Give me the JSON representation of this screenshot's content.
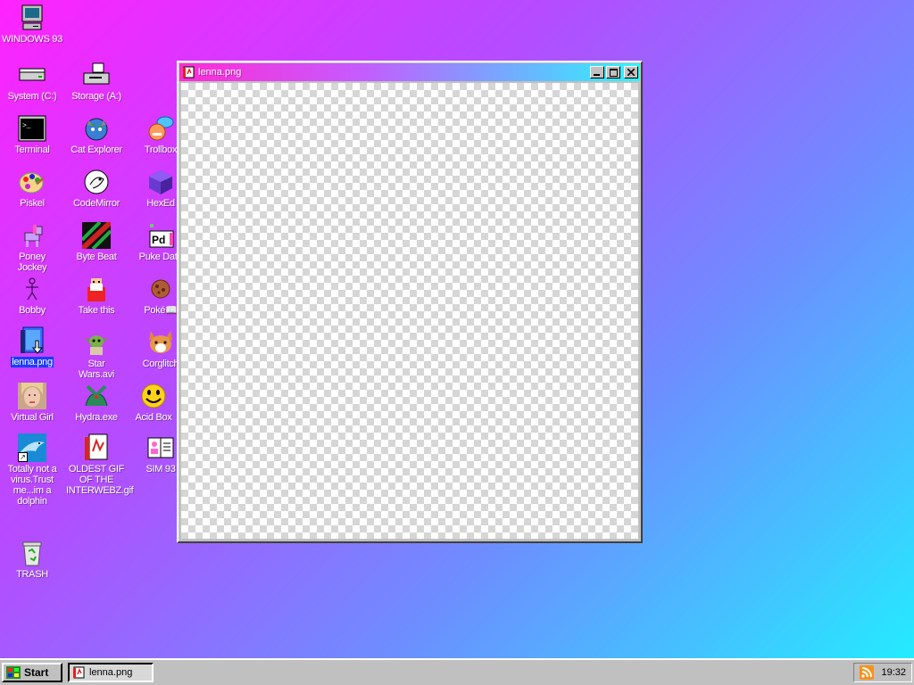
{
  "desktop": {
    "icons": [
      {
        "id": "windows93",
        "label": "WINDOWS 93",
        "icon": "computer-icon"
      },
      {
        "id": "system-c",
        "label": "System (C:)",
        "icon": "hard-drive-icon"
      },
      {
        "id": "storage-a",
        "label": "Storage (A:)",
        "icon": "floppy-drive-icon"
      },
      {
        "id": "terminal",
        "label": "Terminal",
        "icon": "terminal-icon"
      },
      {
        "id": "cat-explorer",
        "label": "Cat Explorer",
        "icon": "cat-globe-icon"
      },
      {
        "id": "trollbox",
        "label": "Trollbox",
        "icon": "chat-face-icon"
      },
      {
        "id": "piskel",
        "label": "Piskel",
        "icon": "paint-palette-icon"
      },
      {
        "id": "codemirror",
        "label": "CodeMirror",
        "icon": "codemirror-icon"
      },
      {
        "id": "hexed",
        "label": "HexEd",
        "icon": "purple-cube-icon"
      },
      {
        "id": "poney-jockey",
        "label": "Poney Jockey",
        "icon": "pony-icon"
      },
      {
        "id": "byte-beat",
        "label": "Byte Beat",
        "icon": "byte-beat-icon"
      },
      {
        "id": "puke-data",
        "label": "Puke Data",
        "icon": "puke-data-icon"
      },
      {
        "id": "bobby",
        "label": "Bobby",
        "icon": "stick-figure-icon"
      },
      {
        "id": "take-this",
        "label": "Take this",
        "icon": "old-man-icon"
      },
      {
        "id": "pokedex",
        "label": "Poké📖",
        "icon": "cookie-icon"
      },
      {
        "id": "lenna",
        "label": "lenna.png",
        "icon": "image-file-icon"
      },
      {
        "id": "star-wars",
        "label": "Star Wars.avi",
        "icon": "yoda-icon"
      },
      {
        "id": "corglitch",
        "label": "Corglitch",
        "icon": "corgi-icon"
      },
      {
        "id": "virtual-girl",
        "label": "Virtual Girl",
        "icon": "face-photo-icon"
      },
      {
        "id": "hydra",
        "label": "Hydra.exe",
        "icon": "dragon-icon"
      },
      {
        "id": "acid-box",
        "label": "Acid Box",
        "icon": "smiley-icon"
      },
      {
        "id": "dolphin",
        "label": "Totally not a virus.Trust me...im a dolphin",
        "icon": "dolphin-icon"
      },
      {
        "id": "oldest-gif",
        "label": "OLDEST GIF OF THE INTERWEBZ.gif",
        "icon": "gif-file-icon"
      },
      {
        "id": "sim93",
        "label": "SIM 93",
        "icon": "sim-book-icon"
      },
      {
        "id": "trash",
        "label": "TRASH",
        "icon": "recycle-bin-icon"
      }
    ]
  },
  "window": {
    "title": "lenna.png",
    "minimize": "_",
    "maximize": "□",
    "close": "✕"
  },
  "taskbar": {
    "start_label": "Start",
    "task_label": "lenna.png",
    "clock": "19:32"
  },
  "colors": {
    "selection": "#1a3cff",
    "taskbar": "#c0c0c0"
  }
}
